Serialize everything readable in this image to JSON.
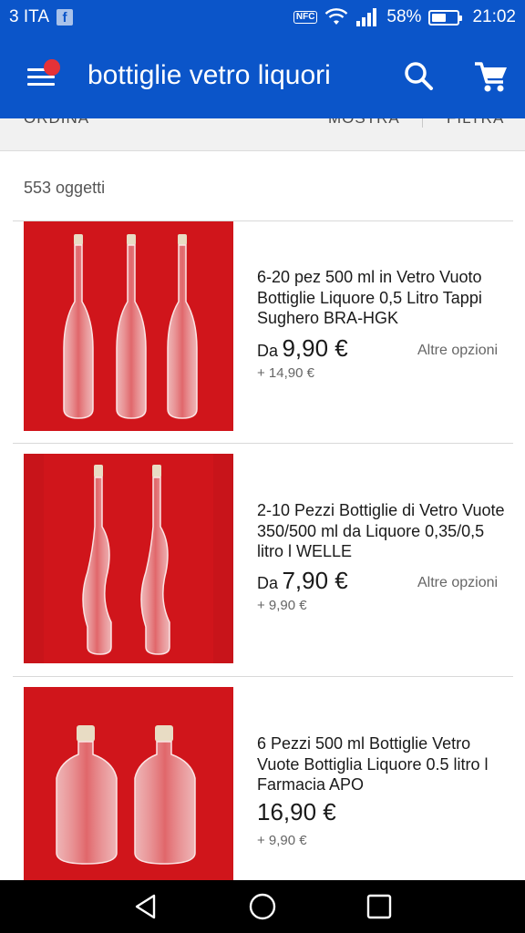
{
  "status_bar": {
    "carrier": "3 ITA",
    "carrier_app_icon": "facebook-icon",
    "icons": [
      "nfc-icon",
      "wifi-icon",
      "signal-icon"
    ],
    "battery_percent": "58%",
    "battery_level": 0.58,
    "time": "21:02"
  },
  "app_bar": {
    "title": "bottiglie vetro liquori",
    "menu_icon": "hamburger-menu-icon",
    "notification_dot_color": "#e53238",
    "background_color": "#0b55c9",
    "actions": [
      "search-icon",
      "cart-icon"
    ]
  },
  "filters": {
    "sort_label": "ORDINA",
    "view_label": "MOSTRA",
    "refine_label": "FILTRA"
  },
  "results": {
    "count_label": "553 oggetti",
    "items": [
      {
        "title": "6-20 pez 500 ml in Vetro Vuoto Bottiglie Liquore 0,5 Litro Tappi Sughero BRA-HGK",
        "price_prefix": "Da",
        "price": "9,90 €",
        "shipping": "+ 14,90 €",
        "more_options": "Altre opzioni",
        "thumbnail": "three-tall-glass-bottles-image"
      },
      {
        "title": "2-10 Pezzi Bottiglie di Vetro Vuote 350/500 ml da Liquore 0,35/0,5 litro l WELLE",
        "price_prefix": "Da",
        "price": "7,90 €",
        "shipping": "+ 9,90 €",
        "more_options": "Altre opzioni",
        "thumbnail": "two-wavy-glass-bottles-image"
      },
      {
        "title": "6 Pezzi 500 ml Bottiglie Vetro Vuote Bottiglia Liquore 0.5 litro l Farmacia APO",
        "price_prefix": "",
        "price": "16,90 €",
        "shipping": "+ 9,90 €",
        "more_options": "",
        "thumbnail": "two-flask-glass-bottles-image"
      }
    ]
  },
  "nav_bar": {
    "buttons": [
      "back-triangle-icon",
      "home-circle-icon",
      "recents-square-icon"
    ]
  }
}
